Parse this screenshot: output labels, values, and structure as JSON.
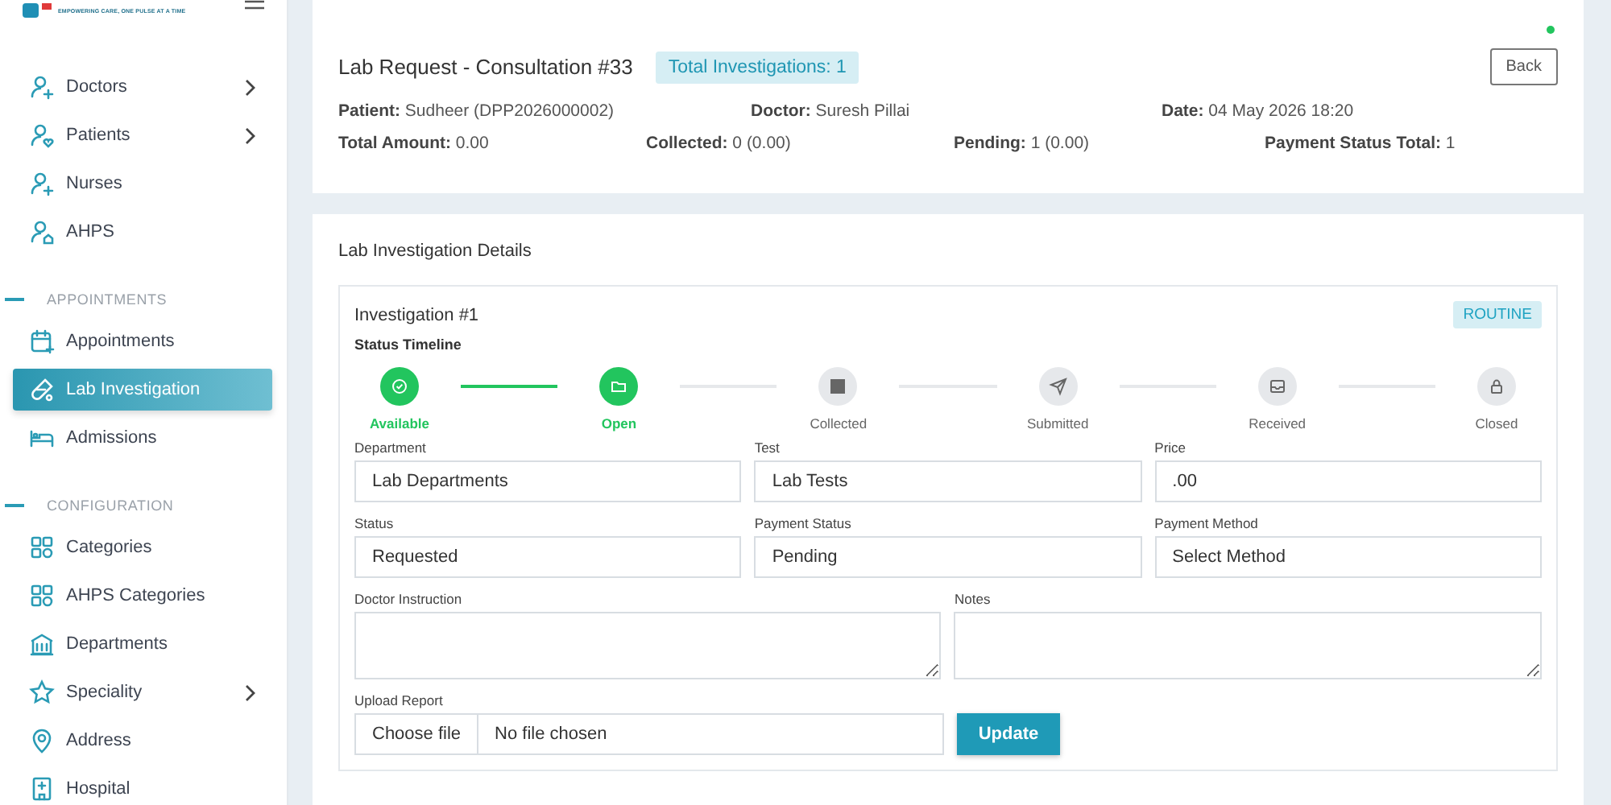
{
  "sidebar": {
    "tagline": "EMPOWERING CARE, ONE PULSE AT A TIME",
    "groups": [
      {
        "items": [
          {
            "label": "Doctors",
            "has_children": true,
            "selected": false
          },
          {
            "label": "Patients",
            "has_children": true,
            "selected": false
          },
          {
            "label": "Nurses",
            "has_children": false,
            "selected": false
          },
          {
            "label": "AHPS",
            "has_children": false,
            "selected": false
          }
        ]
      },
      {
        "title": "APPOINTMENTS",
        "items": [
          {
            "label": "Appointments",
            "has_children": false,
            "selected": false
          },
          {
            "label": "Lab Investigation",
            "has_children": false,
            "selected": true
          },
          {
            "label": "Admissions",
            "has_children": false,
            "selected": false
          }
        ]
      },
      {
        "title": "CONFIGURATION",
        "items": [
          {
            "label": "Categories",
            "has_children": false,
            "selected": false
          },
          {
            "label": "AHPS Categories",
            "has_children": false,
            "selected": false
          },
          {
            "label": "Departments",
            "has_children": false,
            "selected": false
          },
          {
            "label": "Speciality",
            "has_children": true,
            "selected": false
          },
          {
            "label": "Address",
            "has_children": false,
            "selected": false
          },
          {
            "label": "Hospital",
            "has_children": false,
            "selected": false
          }
        ]
      }
    ]
  },
  "header": {
    "title": "Lab Request - Consultation #33",
    "badge": "Total Investigations: 1",
    "back_button": "Back",
    "rows": [
      [
        "**Patient:** Sudheer (DPP2026000002)",
        "**Doctor:** Suresh Pillai",
        "**Date:** 04 May 2026 18:20"
      ],
      [
        "**Total Amount:** 0.00",
        "**Collected:** 0 (0.00)",
        "**Pending:** 1 (0.00)",
        "**Payment Status Total:** 1"
      ]
    ]
  },
  "details": {
    "title": "Lab Investigation Details",
    "investigation": {
      "title": "Investigation #1",
      "priority": "ROUTINE",
      "timeline_title": "Status Timeline",
      "steps": [
        {
          "label": "Available",
          "completed": true
        },
        {
          "label": "Open",
          "completed": true
        },
        {
          "label": "Collected",
          "completed": false
        },
        {
          "label": "Submitted",
          "completed": false
        },
        {
          "label": "Received",
          "completed": false
        },
        {
          "label": "Closed",
          "completed": false
        }
      ],
      "fields": [
        {
          "kind": "input",
          "label": "Department",
          "value": "Lab Departments"
        },
        {
          "kind": "input",
          "label": "Test",
          "value": "Lab Tests"
        },
        {
          "kind": "input",
          "label": "Price",
          "value": ".00"
        },
        {
          "kind": "input",
          "label": "Status",
          "value": "Requested"
        },
        {
          "kind": "input",
          "label": "Payment Status",
          "value": "Pending"
        },
        {
          "kind": "input",
          "label": "Payment Method",
          "value": "Select Method"
        },
        {
          "kind": "textarea",
          "label": "Doctor Instruction"
        },
        {
          "kind": "textarea",
          "label": "Notes"
        }
      ],
      "upload": {
        "label": "Upload Report",
        "button": "Choose file",
        "status": "No file chosen"
      },
      "submit": "Update"
    }
  }
}
